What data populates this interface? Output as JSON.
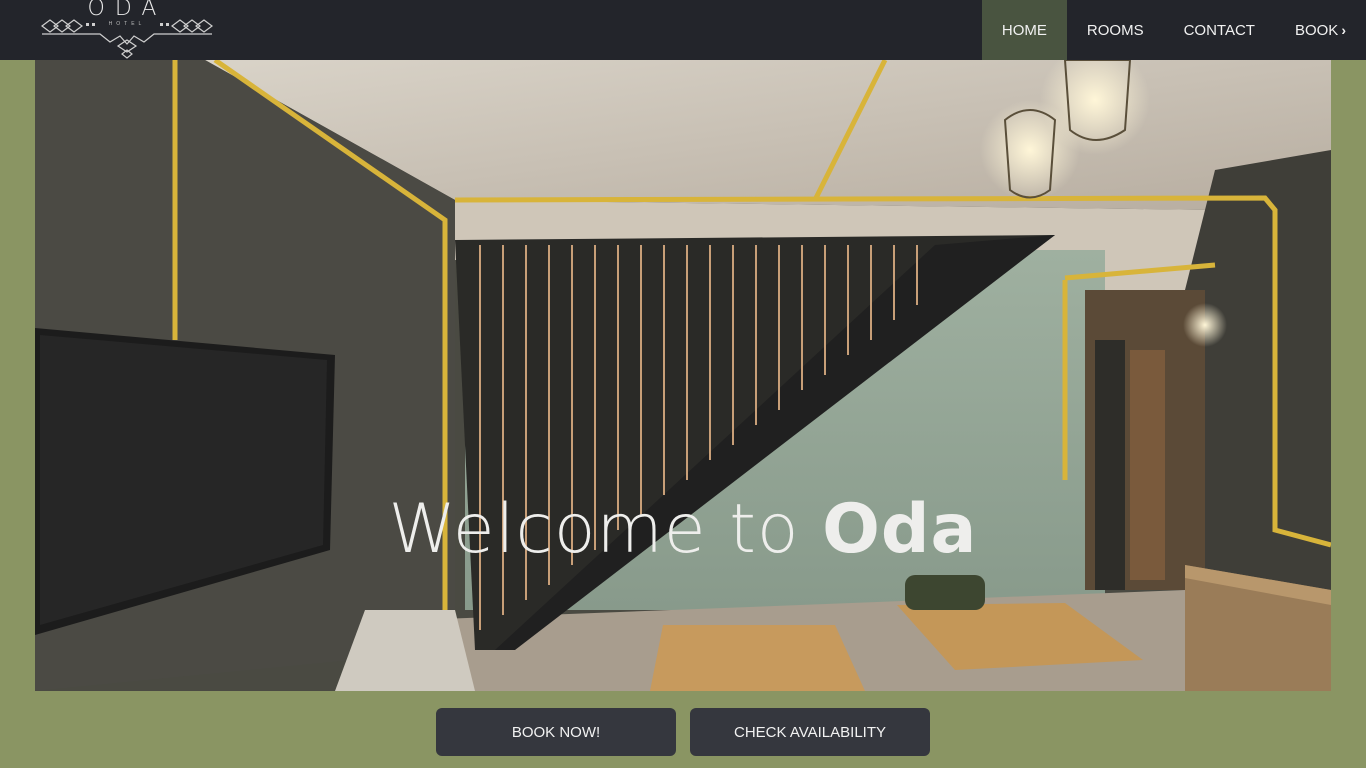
{
  "brand": {
    "name": "ODA",
    "tagline": "HOTEL"
  },
  "nav": {
    "items": [
      {
        "label": "HOME",
        "active": true
      },
      {
        "label": "ROOMS",
        "active": false
      },
      {
        "label": "CONTACT",
        "active": false
      },
      {
        "label": "BOOK",
        "active": false
      }
    ],
    "book_icon": "chevron-right-icon"
  },
  "hero": {
    "welcome_prefix": "Welcome to ",
    "welcome_name": "Oda",
    "image_description_icon": "photo-room-interior"
  },
  "actions": {
    "book_now": "BOOK NOW!",
    "check_availability": "CHECK AVAILABILITY"
  },
  "colors": {
    "page_background": "#8a9563",
    "topbar": "#23252b",
    "nav_active": "#495440",
    "button": "#35373e"
  }
}
